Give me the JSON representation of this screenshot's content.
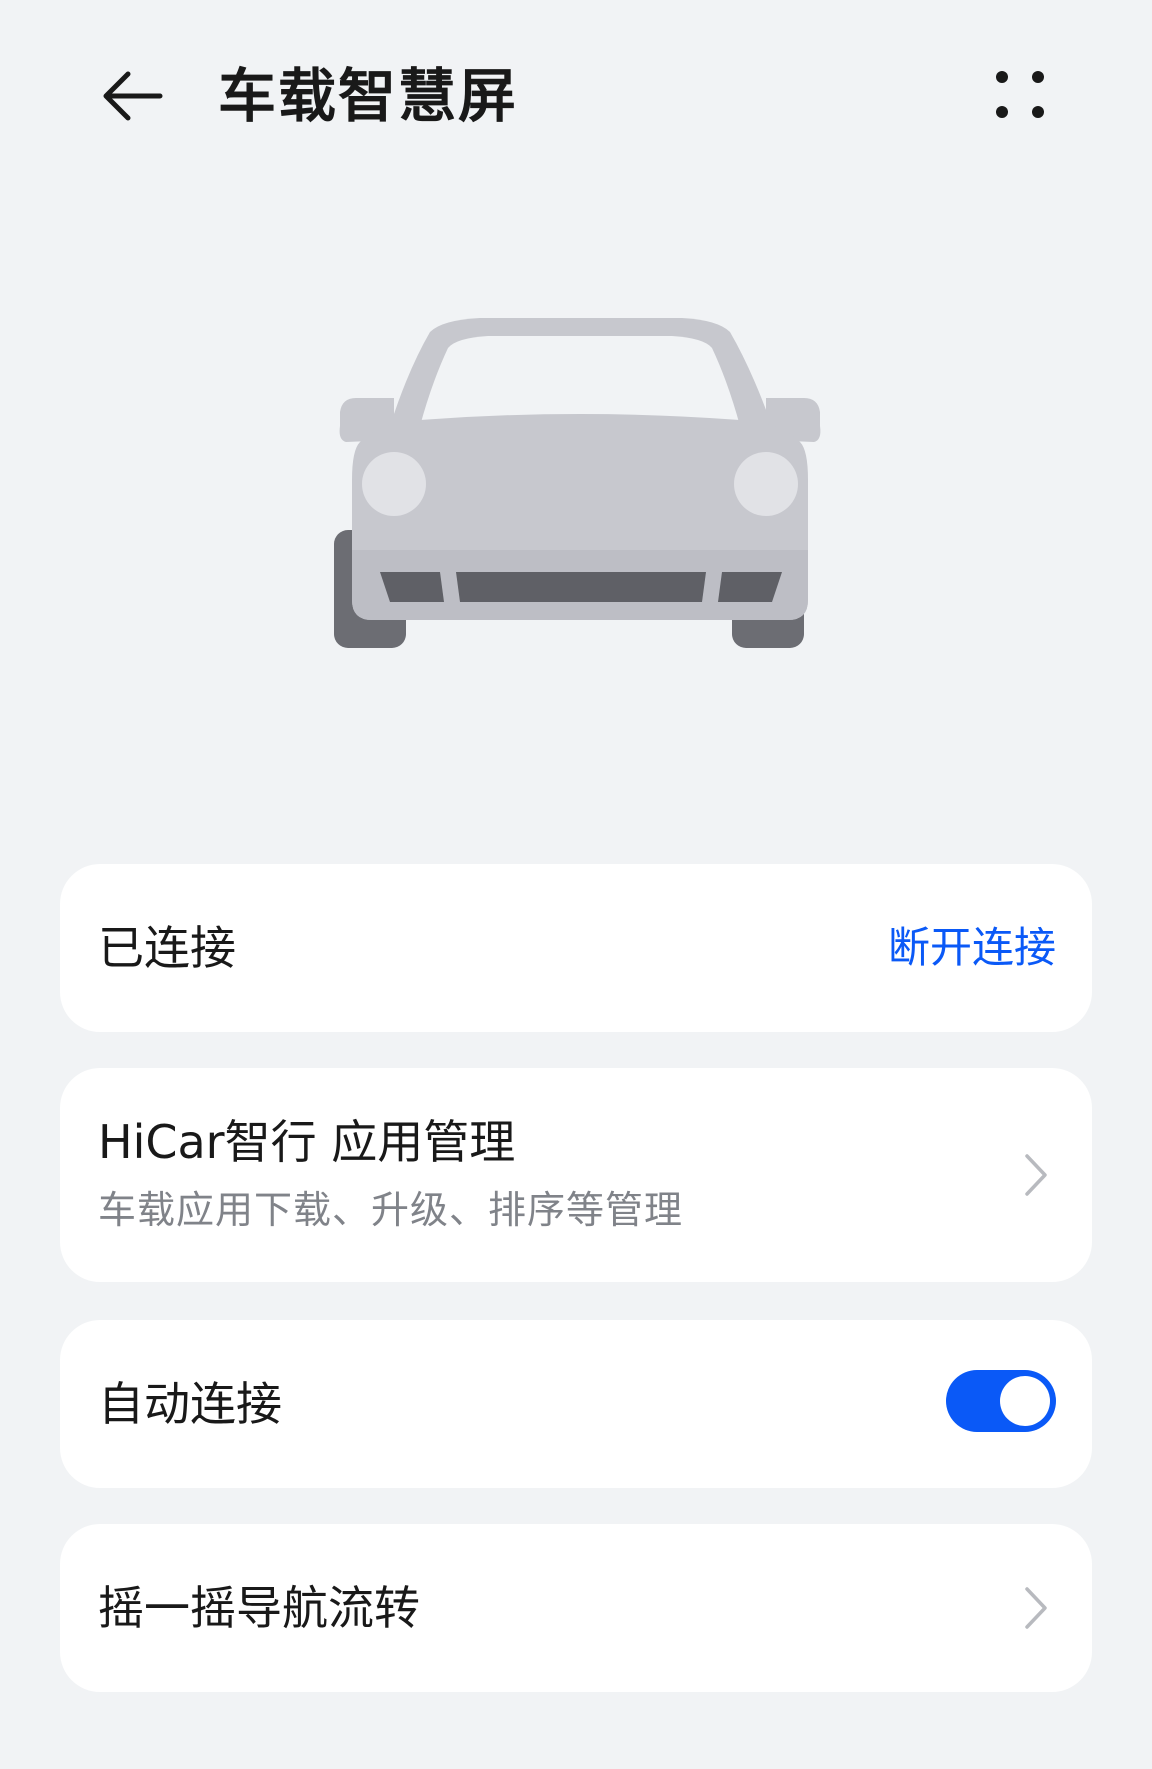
{
  "header": {
    "title": "车载智慧屏",
    "back_icon": "arrow-left-icon",
    "more_icon": "more-dots-icon"
  },
  "hero": {
    "icon": "car-icon"
  },
  "connection": {
    "status_label": "已连接",
    "disconnect_label": "断开连接",
    "accent_color": "#0a59f7"
  },
  "hicar": {
    "title": "HiCar智行 应用管理",
    "subtitle": "车载应用下载、升级、排序等管理"
  },
  "auto_connect": {
    "label": "自动连接",
    "enabled": true
  },
  "shake": {
    "label": "摇一摇导航流转"
  }
}
